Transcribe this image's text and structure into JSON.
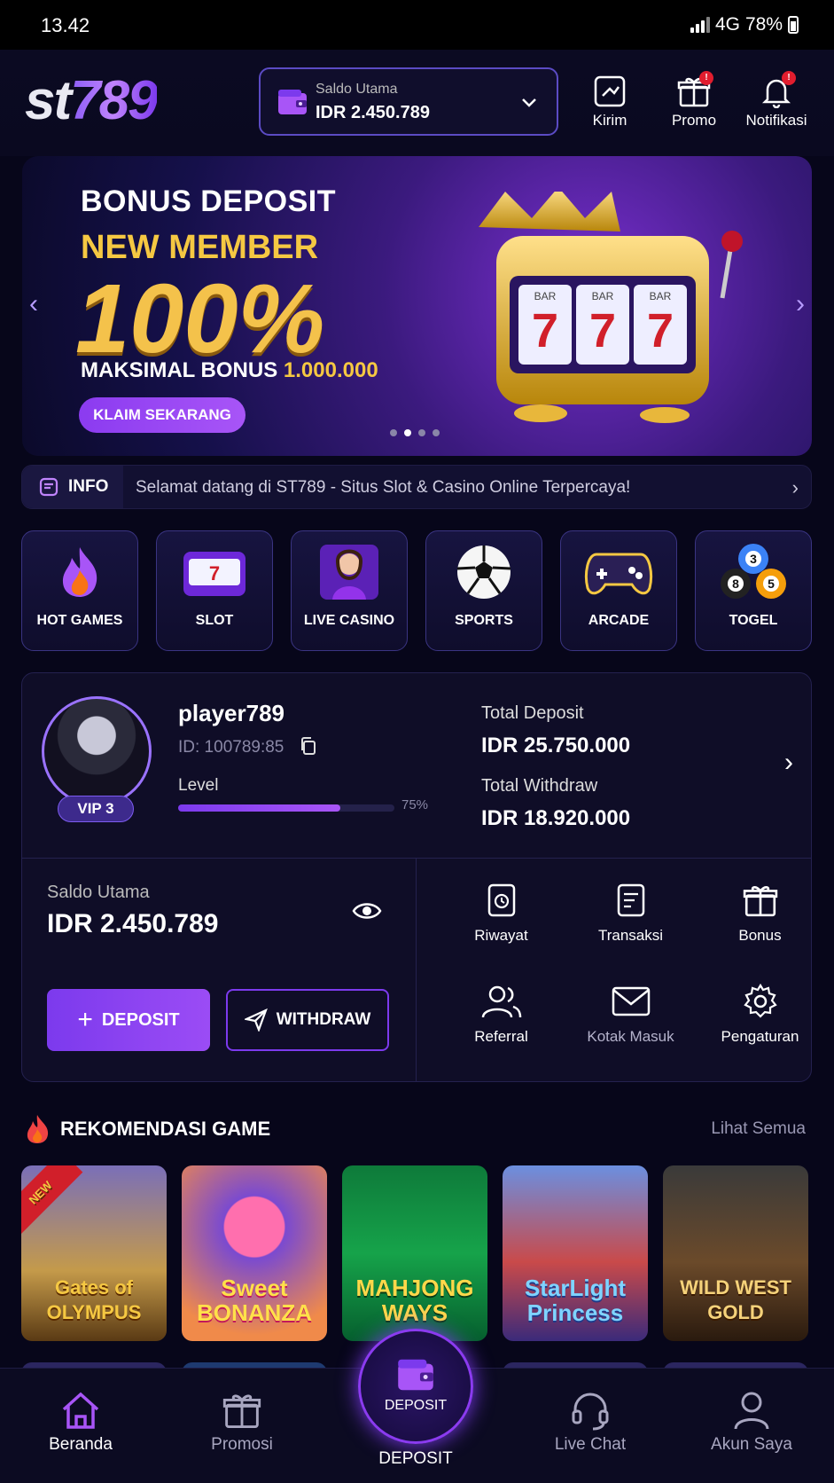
{
  "status": {
    "time": "13.42",
    "network": "4G",
    "battery": "78%"
  },
  "header": {
    "logo_part1": "st",
    "logo_part2": "789",
    "wallet_label": "Saldo Utama",
    "wallet_value": "IDR 2.450.789",
    "buttons": [
      {
        "label": "Kirim",
        "icon": "send-icon"
      },
      {
        "label": "Promo",
        "icon": "gift-icon",
        "badge": "!"
      },
      {
        "label": "Notifikasi",
        "icon": "bell-icon",
        "badge": "!"
      }
    ]
  },
  "banner": {
    "line1": "BONUS DEPOSIT",
    "line2": "NEW MEMBER",
    "line3": "100%",
    "line4_prefix": "MAKSIMAL BONUS ",
    "line4_amount": "1.000.000",
    "cta": "KLAIM SEKARANG",
    "slot_labels": [
      "BAR",
      "BAR",
      "BAR"
    ],
    "slot_symbols": [
      "7",
      "7",
      "7"
    ]
  },
  "info": {
    "tag": "INFO",
    "message": "Selamat datang di ST789 - Situs Slot & Casino Online Terpercaya!"
  },
  "categories": [
    {
      "label": "HOT GAMES",
      "icon": "fire-icon"
    },
    {
      "label": "SLOT",
      "icon": "slot-machine-icon"
    },
    {
      "label": "LIVE CASINO",
      "icon": "dealer-icon"
    },
    {
      "label": "SPORTS",
      "icon": "soccer-ball-icon"
    },
    {
      "label": "ARCADE",
      "icon": "gamepad-icon"
    },
    {
      "label": "TOGEL",
      "icon": "lottery-balls-icon"
    }
  ],
  "togel_balls": [
    "3",
    "8",
    "5"
  ],
  "profile": {
    "username": "player789",
    "id": "ID: 100789:85",
    "vip": "VIP 3",
    "level_label": "Level",
    "level_progress": 0.75,
    "level_pct_text": "75%",
    "total_deposit_label": "Total Deposit",
    "total_deposit": "IDR 25.750.000",
    "total_withdraw_label": "Total Withdraw",
    "total_withdraw": "IDR 18.920.000"
  },
  "balance": {
    "label": "Saldo Utama",
    "value": "IDR 2.450.789",
    "deposit_btn": "DEPOSIT",
    "withdraw_btn": "WITHDRAW"
  },
  "quick_actions": [
    {
      "label": "Riwayat",
      "icon": "history-icon"
    },
    {
      "label": "Transaksi",
      "icon": "transaction-icon"
    },
    {
      "label": "Bonus",
      "icon": "gift-icon"
    },
    {
      "label": "Referral",
      "icon": "users-icon"
    },
    {
      "label": "Kotak Masuk",
      "icon": "mail-icon"
    },
    {
      "label": "Pengaturan",
      "icon": "gear-icon"
    }
  ],
  "recommend": {
    "title": "REKOMENDASI GAME",
    "see_all": "Lihat Semua",
    "games": [
      {
        "name": "Gates of OLYMPUS",
        "badge": "NEW"
      },
      {
        "name": "Sweet BONANZA"
      },
      {
        "name": "MAHJONG WAYS"
      },
      {
        "name": "StarLight Princess"
      },
      {
        "name": "WILD WEST GOLD"
      }
    ]
  },
  "nav": {
    "items": [
      {
        "label": "Beranda",
        "icon": "home-icon"
      },
      {
        "label": "Promosi",
        "icon": "gift-icon"
      },
      {
        "label": "Live Chat",
        "icon": "headset-icon"
      },
      {
        "label": "Akun Saya",
        "icon": "user-icon"
      }
    ],
    "fab_inner": "DEPOSIT",
    "fab_label": "DEPOSIT"
  },
  "colors": {
    "accent": "#8b3bf0",
    "gold": "#f5c842",
    "background": "#07061a"
  }
}
